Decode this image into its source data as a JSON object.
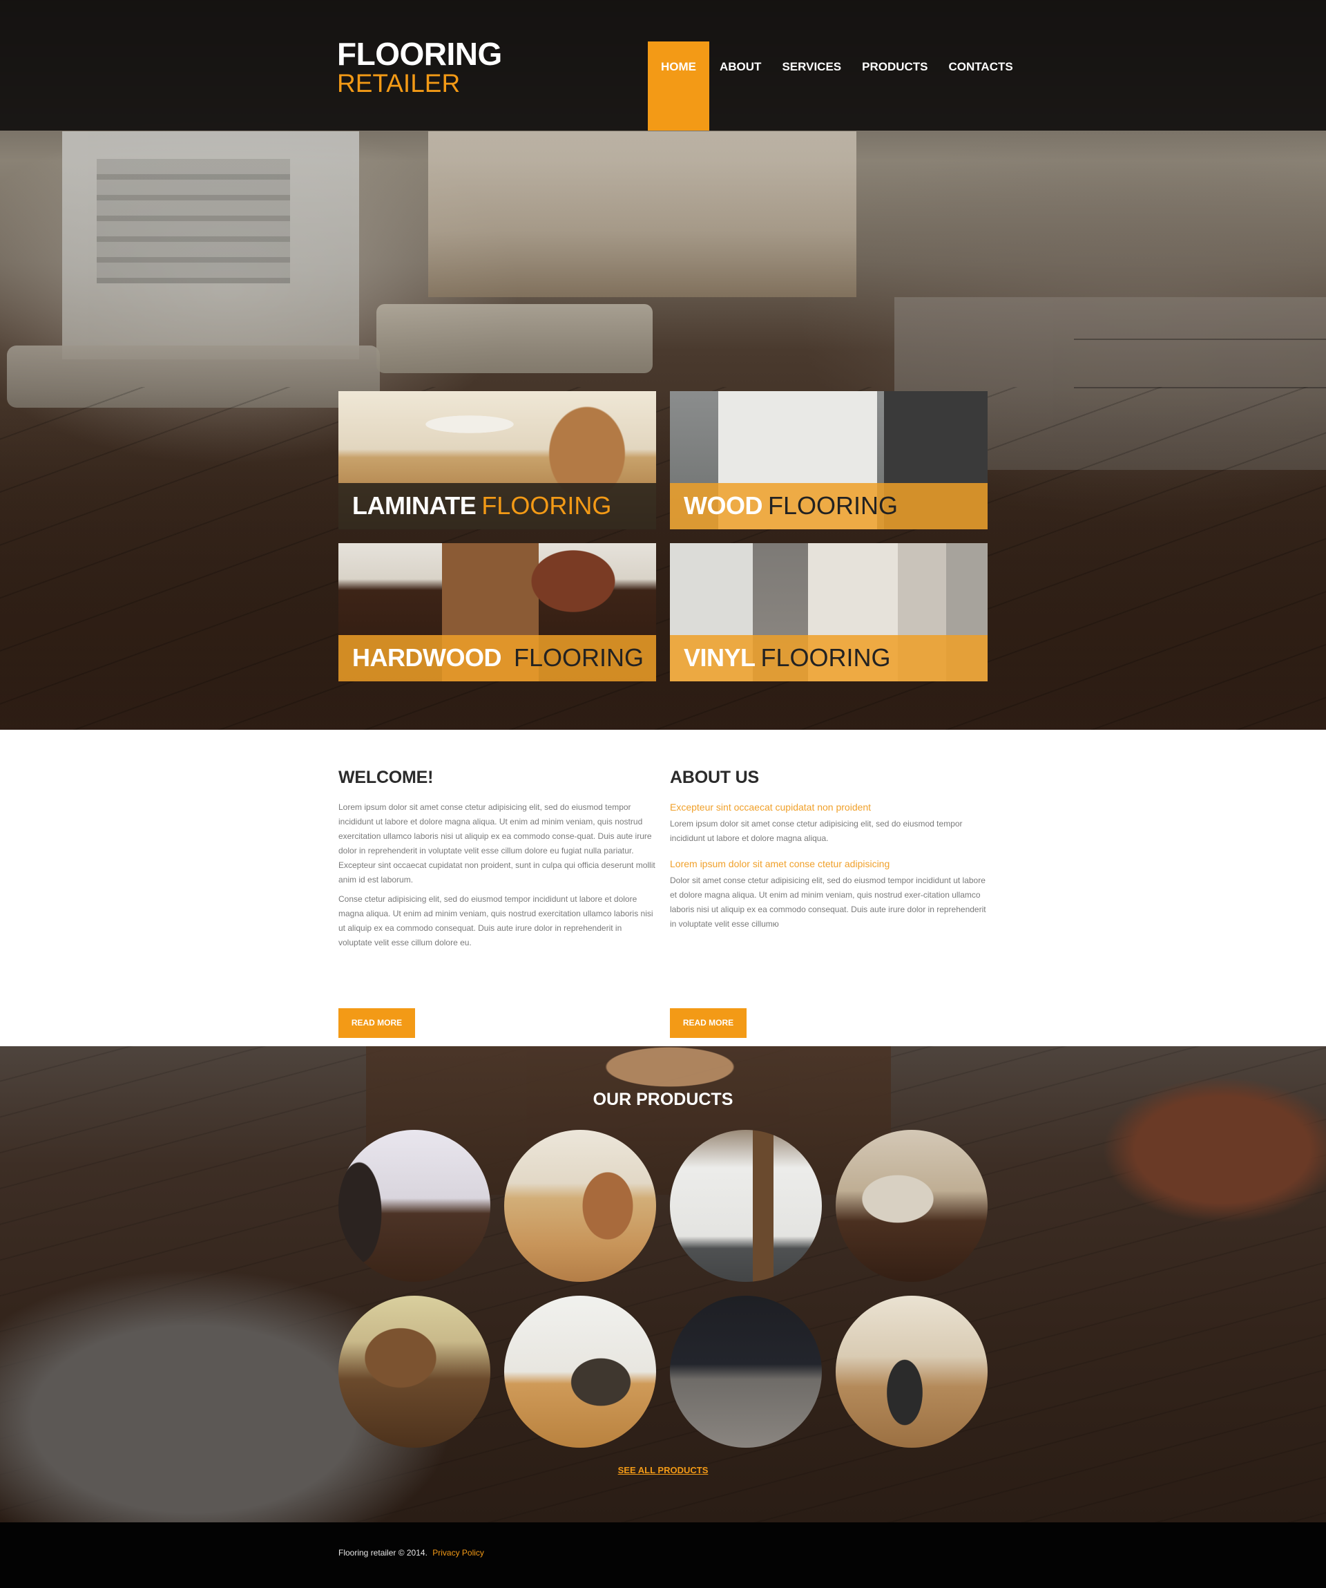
{
  "brand": {
    "line1": "FLOORING",
    "line2": "RETAILER"
  },
  "nav": {
    "items": [
      {
        "label": "HOME",
        "active": true
      },
      {
        "label": "ABOUT",
        "active": false
      },
      {
        "label": "SERVICES",
        "active": false
      },
      {
        "label": "PRODUCTS",
        "active": false
      },
      {
        "label": "CONTACTS",
        "active": false
      }
    ]
  },
  "categories": [
    {
      "strong": "LAMINATE",
      "light": "FLOORING",
      "style": "dark"
    },
    {
      "strong": "WOOD",
      "light": "FLOORING",
      "style": "orange"
    },
    {
      "strong": "HARDWOOD",
      "light": "FLOORING",
      "style": "orange"
    },
    {
      "strong": "VINYL",
      "light": "FLOORING",
      "style": "orange"
    }
  ],
  "welcome": {
    "title": "WELCOME!",
    "paragraphs": [
      "Lorem ipsum dolor sit amet conse ctetur adipisicing elit, sed do eiusmod tempor incididunt ut labore et dolore magna aliqua. Ut enim ad minim veniam, quis nostrud exercitation ullamco laboris nisi ut aliquip ex ea commodo conse-quat. Duis aute irure dolor in reprehenderit in voluptate velit esse cillum dolore eu fugiat nulla pariatur. Excepteur sint occaecat cupidatat non proident, sunt in culpa qui officia deserunt mollit anim id est laborum.",
      "Conse ctetur adipisicing elit, sed do eiusmod tempor incididunt ut labore et dolore magna aliqua. Ut enim ad minim veniam, quis nostrud exercitation ullamco laboris nisi ut aliquip ex ea commodo consequat. Duis aute irure dolor in reprehenderit in voluptate velit esse cillum dolore eu."
    ],
    "button": "READ MORE"
  },
  "about": {
    "title": "ABOUT US",
    "items": [
      {
        "heading": "Excepteur sint occaecat cupidatat non proident",
        "text": "Lorem ipsum dolor sit amet conse ctetur adipisicing elit, sed do eiusmod tempor incididunt ut labore et dolore magna aliqua."
      },
      {
        "heading": "Lorem ipsum dolor sit amet conse ctetur adipisicing",
        "text": "Dolor sit amet conse ctetur adipisicing elit, sed do eiusmod tempor incididunt ut labore et dolore magna aliqua. Ut enim ad minim veniam, quis nostrud exer-citation ullamco laboris nisi ut aliquip ex ea commodo consequat. Duis aute irure dolor in reprehenderit in voluptate velit esse cillumю"
      }
    ],
    "button": "READ MORE"
  },
  "products": {
    "title": "OUR PRODUCTS",
    "items": [
      {
        "name": "product-1"
      },
      {
        "name": "product-2"
      },
      {
        "name": "product-3"
      },
      {
        "name": "product-4"
      },
      {
        "name": "product-5"
      },
      {
        "name": "product-6"
      },
      {
        "name": "product-7"
      },
      {
        "name": "product-8"
      }
    ],
    "see_all": "SEE ALL PRODUCTS"
  },
  "footer": {
    "copyright": "Flooring retailer © 2014.",
    "privacy": "Privacy Policy"
  },
  "colors": {
    "accent": "#f39a16",
    "header_bg": "#12100f",
    "footer_bg": "#030303"
  }
}
